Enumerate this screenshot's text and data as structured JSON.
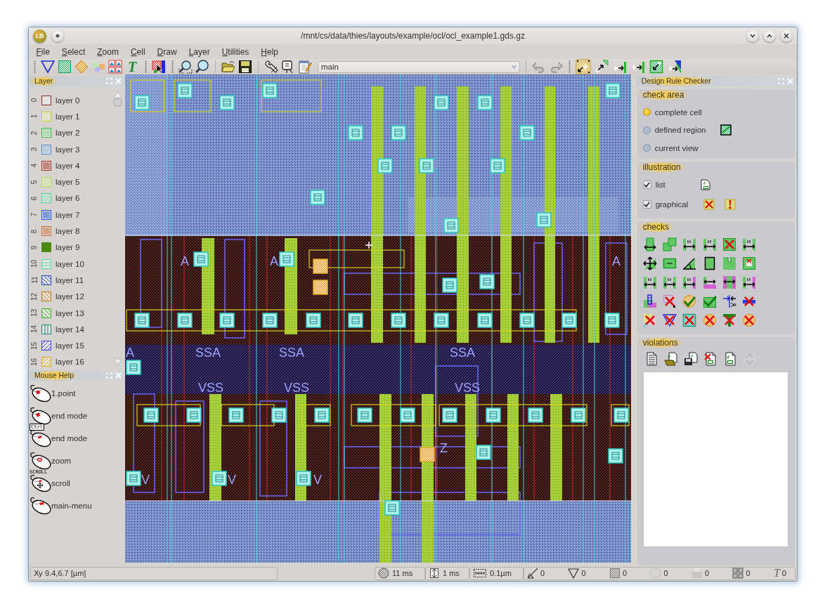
{
  "window": {
    "logo": "LB",
    "title": "/mnt/cs/data/thies/layouts/example/ocl/ocl_example1.gds.gz"
  },
  "menu": [
    "File",
    "Select",
    "Zoom",
    "Cell",
    "Draw",
    "Layer",
    "Utilities",
    "Help"
  ],
  "toolbar": {
    "text_glyph": "T",
    "cell": {
      "value": "main"
    },
    "modes": [
      {
        "selected": true
      },
      {
        "selected": false
      },
      {
        "selected": false
      },
      {
        "selected": false
      },
      {
        "selected": false
      },
      {
        "selected": false
      }
    ]
  },
  "layer_panel": {
    "title": "Layer",
    "layers": [
      {
        "number": "0",
        "label": "layer 0",
        "color": "#8c2a2a",
        "kind": "outline"
      },
      {
        "number": "1",
        "label": "layer 1",
        "color": "#c4d41c",
        "kind": "sparse"
      },
      {
        "number": "2",
        "label": "layer 2",
        "color": "#22c03a",
        "kind": "dots"
      },
      {
        "number": "3",
        "label": "layer 3",
        "color": "#3a86c8",
        "kind": "dots"
      },
      {
        "number": "4",
        "label": "layer 4",
        "color": "#a2261a",
        "kind": "dense"
      },
      {
        "number": "5",
        "label": "layer 5",
        "color": "#a6e03a",
        "kind": "dots"
      },
      {
        "number": "6",
        "label": "layer 6",
        "color": "#3ed88e",
        "kind": "dots"
      },
      {
        "number": "7",
        "label": "layer 7",
        "color": "#1a4ee0",
        "kind": "dense"
      },
      {
        "number": "8",
        "label": "layer 8",
        "color": "#c0642c",
        "kind": "dense"
      },
      {
        "number": "9",
        "label": "layer 9",
        "color": "#4a8c12",
        "kind": "solid"
      },
      {
        "number": "10",
        "label": "layer 10",
        "color": "#4ee0a8",
        "kind": "hlines"
      },
      {
        "number": "11",
        "label": "layer 11",
        "color": "#2244cc",
        "kind": "bdiag"
      },
      {
        "number": "12",
        "label": "layer 12",
        "color": "#c47c14",
        "kind": "bdiag"
      },
      {
        "number": "13",
        "label": "layer 13",
        "color": "#44b02a",
        "kind": "bdiag"
      },
      {
        "number": "14",
        "label": "layer 14",
        "color": "#1a8c78",
        "kind": "vlines"
      },
      {
        "number": "15",
        "label": "layer 15",
        "color": "#4444ee",
        "kind": "fdiag"
      },
      {
        "number": "16",
        "label": "layer 16",
        "color": "#dcae1c",
        "kind": "fdiag"
      }
    ]
  },
  "mouse_help": {
    "title": "Mouse Help",
    "entries": [
      {
        "label": "1.point",
        "kind": "left"
      },
      {
        "label": "end mode",
        "kind": "left"
      },
      {
        "label": "end mode",
        "kind": "middle",
        "modifier": "Ctrl"
      },
      {
        "label": "zoom",
        "kind": "wheel"
      },
      {
        "label": "scroll",
        "kind": "scroll",
        "modifier": "SCROLL"
      },
      {
        "label": "main-menu",
        "kind": "right"
      }
    ]
  },
  "canvas": {
    "labels": [
      "A",
      "A",
      "A",
      "A",
      "SSA",
      "SSA",
      "SSA",
      "VSS",
      "VSS",
      "VSS",
      "Z",
      "V",
      "V",
      "V"
    ]
  },
  "drc": {
    "title": "Design Rule Checker",
    "check_area": {
      "title": "check area",
      "options": [
        {
          "label": "complete cell",
          "selected": true
        },
        {
          "label": "defined region",
          "selected": false
        },
        {
          "label": "current view",
          "selected": false
        }
      ]
    },
    "illustration": {
      "title": "illustration",
      "options": [
        {
          "label": "list",
          "checked": true
        },
        {
          "label": "graphical",
          "checked": true
        }
      ]
    },
    "checks": {
      "title": "checks"
    },
    "violations": {
      "title": "violations",
      "tools": [
        {
          "disabled": false
        },
        {
          "disabled": false
        },
        {
          "disabled": false
        },
        {
          "disabled": false
        },
        {
          "disabled": false
        },
        {
          "disabled": true
        }
      ]
    }
  },
  "status_bar": {
    "axis_label": "Xy",
    "position": "9.4,6.7 [µm]",
    "timings": [
      "11 ms",
      "1 ms"
    ],
    "grid": "0.1µm",
    "counters": [
      {
        "value": "0"
      },
      {
        "value": "0"
      },
      {
        "value": "0"
      },
      {
        "value": "0"
      },
      {
        "value": "0"
      },
      {
        "value": "0"
      },
      {
        "glyph": "T",
        "value": "0"
      }
    ]
  }
}
